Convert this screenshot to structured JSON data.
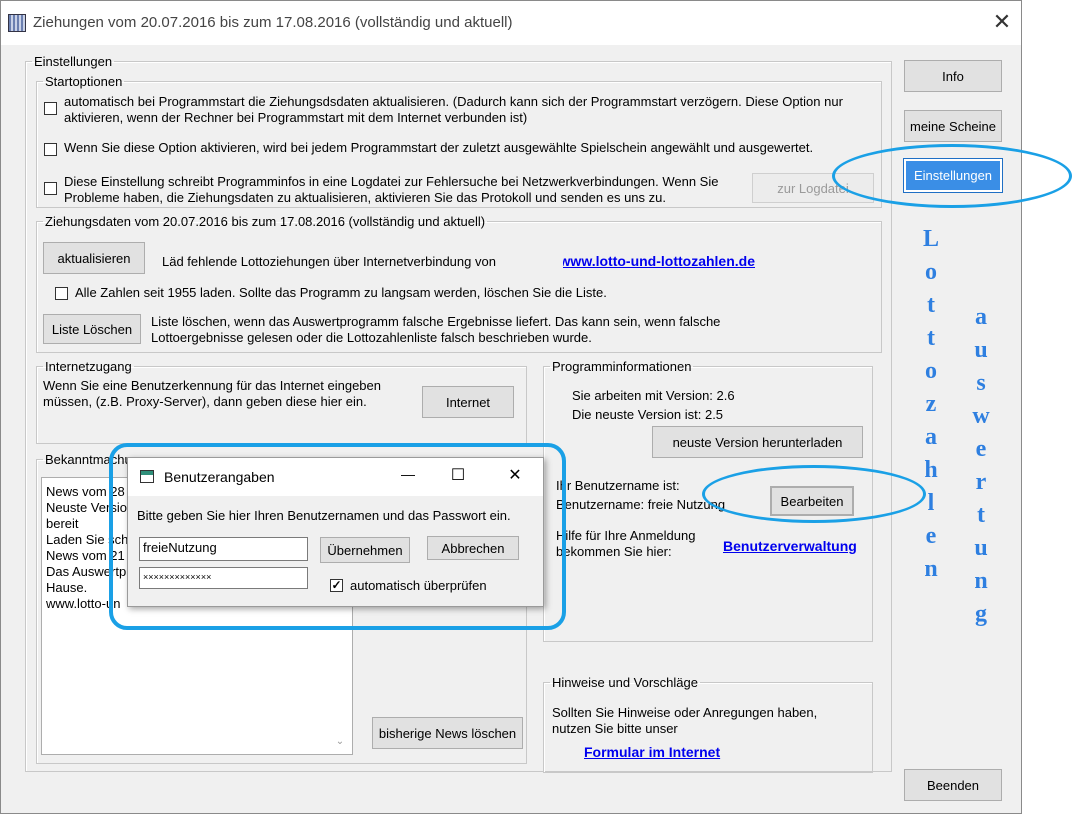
{
  "window": {
    "title": "Ziehungen vom 20.07.2016 bis zum 17.08.2016 (vollständig und aktuell)",
    "close_glyph": "✕"
  },
  "right_buttons": {
    "info": "Info",
    "meine_scheine": "meine Scheine",
    "einstellungen": "Einstellungen",
    "beenden": "Beenden"
  },
  "einstellungen": {
    "legend": "Einstellungen",
    "startoptionen": {
      "legend": "Startoptionen",
      "option1": "automatisch bei Programmstart die Ziehungsdsdaten aktualisieren. (Dadurch kann sich der Programmstart verzögern. Diese Option nur aktivieren, wenn der Rechner bei Programmstart mit dem Internet verbunden ist)",
      "option2": "Wenn Sie diese Option aktivieren, wird bei jedem Programmstart der zuletzt ausgewählte Spielschein angewählt und ausgewertet.",
      "option3": "Diese Einstellung schreibt Programminfos in eine Logdatei zur Fehlersuche bei Netzwerkverbindungen. Wenn Sie Probleme haben, die Ziehungsdaten zu aktualisieren, aktivieren Sie das Protokoll und senden es uns zu.",
      "logdatei_button": "zur Logdatei"
    },
    "ziehungsdaten": {
      "legend": "Ziehungsdaten vom 20.07.2016 bis zum 17.08.2016 (vollständig und aktuell)",
      "aktualisieren_button": "aktualisieren",
      "aktualisieren_text": "Läd fehlende Lottoziehungen über Internetverbindung von",
      "link": "www.lotto-und-lottozahlen.de",
      "alle_zahlen": "Alle Zahlen seit 1955 laden. Sollte das Programm zu langsam werden, löschen Sie die Liste.",
      "liste_loeschen_button": "Liste Löschen",
      "liste_loeschen_text": "Liste löschen, wenn das Auswertprogramm falsche Ergebnisse liefert. Das kann sein, wenn falsche Lottoergebnisse gelesen oder die Lottozahlenliste falsch beschrieben wurde."
    },
    "internetzugang": {
      "legend": "Internetzugang",
      "text": "Wenn Sie eine Benutzerkennung für das Internet eingeben müssen, (z.B. Proxy-Server), dann geben diese hier ein.",
      "button": "Internet"
    },
    "bekanntmachung": {
      "legend": "Bekanntmachungen",
      "lines": [
        "News vom 28",
        "Neuste Versio",
        "bereit",
        "Laden Sie sch",
        "News vom 21",
        "Das Auswertp",
        "Hause.",
        "www.lotto-un"
      ],
      "delete_button": "bisherige News löschen"
    },
    "programminformationen": {
      "legend": "Programminformationen",
      "version": "Sie arbeiten mit Version: 2.6",
      "newest": "Die neuste Version ist: 2.5",
      "download_button": "neuste Version herunterladen",
      "username_label": "Ihr Benutzername ist:",
      "username_value": "Benutzername: freie Nutzung",
      "edit_button": "Bearbeiten",
      "help_text": "Hilfe für Ihre Anmeldung bekommen Sie hier:",
      "help_link": "Benutzerverwaltung"
    },
    "hinweise": {
      "legend": "Hinweise und Vorschläge",
      "text": "Sollten Sie Hinweise oder Anregungen haben, nutzen Sie bitte unser",
      "link": "Formular im Internet"
    }
  },
  "dialog": {
    "title": "Benutzerangaben",
    "prompt": "Bitte geben Sie hier Ihren Benutzernamen und das Passwort ein.",
    "username_value": "freieNutzung",
    "password_value": "×××××××××××××",
    "apply_button": "Übernehmen",
    "cancel_button": "Abbrechen",
    "auto_check_label": "automatisch überprüfen",
    "auto_check_checked": true,
    "minimize_glyph": "—",
    "maximize_glyph": "☐",
    "close_glyph": "✕"
  },
  "branding": {
    "lottozahlen": [
      "L",
      "o",
      "t",
      "t",
      "o",
      "z",
      "a",
      "h",
      "l",
      "e",
      "n"
    ],
    "auswertung": [
      "a",
      "u",
      "s",
      "w",
      "e",
      "r",
      "t",
      "u",
      "n",
      "g"
    ],
    "color": "#2e7fe0"
  },
  "highlight_color": "#1aa0e6"
}
